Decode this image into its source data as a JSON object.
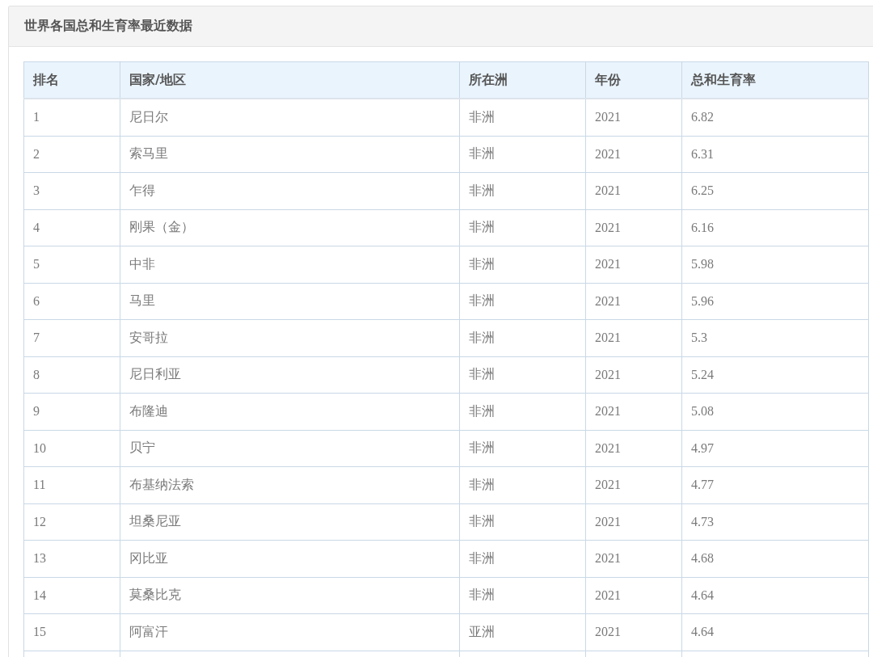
{
  "panel": {
    "title": "世界各国总和生育率最近数据"
  },
  "table": {
    "columns": [
      "排名",
      "国家/地区",
      "所在洲",
      "年份",
      "总和生育率"
    ],
    "rows": [
      [
        "1",
        "尼日尔",
        "非洲",
        "2021",
        "6.82"
      ],
      [
        "2",
        "索马里",
        "非洲",
        "2021",
        "6.31"
      ],
      [
        "3",
        "乍得",
        "非洲",
        "2021",
        "6.25"
      ],
      [
        "4",
        "刚果（金）",
        "非洲",
        "2021",
        "6.16"
      ],
      [
        "5",
        "中非",
        "非洲",
        "2021",
        "5.98"
      ],
      [
        "6",
        "马里",
        "非洲",
        "2021",
        "5.96"
      ],
      [
        "7",
        "安哥拉",
        "非洲",
        "2021",
        "5.3"
      ],
      [
        "8",
        "尼日利亚",
        "非洲",
        "2021",
        "5.24"
      ],
      [
        "9",
        "布隆迪",
        "非洲",
        "2021",
        "5.08"
      ],
      [
        "10",
        "贝宁",
        "非洲",
        "2021",
        "4.97"
      ],
      [
        "11",
        "布基纳法索",
        "非洲",
        "2021",
        "4.77"
      ],
      [
        "12",
        "坦桑尼亚",
        "非洲",
        "2021",
        "4.73"
      ],
      [
        "13",
        "冈比亚",
        "非洲",
        "2021",
        "4.68"
      ],
      [
        "14",
        "莫桑比克",
        "非洲",
        "2021",
        "4.64"
      ],
      [
        "15",
        "阿富汗",
        "亚洲",
        "2021",
        "4.64"
      ]
    ]
  }
}
